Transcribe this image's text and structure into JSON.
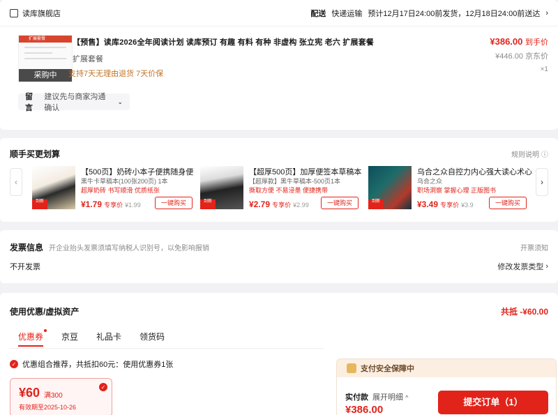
{
  "order": {
    "shop_name": "读库旗舰店",
    "ship_prefix": "配送",
    "ship_method": "快递运输",
    "ship_eta": "预计12月17日24:00前发货，12月18日24:00前送达",
    "product": {
      "thumb_header": "扩展套餐",
      "thumb_tag": "采购中",
      "title": "【预售】读库2026全年阅读计划 读库预订 有趣 有料 有种 非虚构 张立宪 老六 扩展套餐",
      "spec": "扩展套餐",
      "service": "支持7天无理由退货  7天价保",
      "price": "¥386.00",
      "price_tag": "到手价",
      "original_price": "¥446.00",
      "original_tag": "京东价",
      "qty": "×1"
    },
    "memo_label": "留言",
    "memo_value": "建议先与商家沟通确认"
  },
  "recommend": {
    "title": "顺手买更划算",
    "rule_link": "规则说明",
    "items": [
      {
        "name": "【500页】奶砖小本子便携随身便",
        "sub": "黑牛卡草稿本(100张200页)  1本",
        "tags": "超厚奶砖 书写顺滑 优质纸张",
        "price": "¥1.79",
        "price_tag": "专享价",
        "orig": "¥1.99",
        "buy": "一键购买",
        "badge": "到新"
      },
      {
        "name": "【超厚500页】加厚便签本草稿本",
        "sub": "【超厚款】黑牛草稿本-500页1本",
        "tags": "撕取方便 不易浸墨 便捷携带",
        "price": "¥2.79",
        "price_tag": "专享价",
        "orig": "¥2.99",
        "buy": "一键购买",
        "badge": "到新"
      },
      {
        "name": "乌合之众自控力内心强大读心术心",
        "sub": "乌合之众",
        "tags": "职场洞察 掌握心理 正版图书",
        "price": "¥3.49",
        "price_tag": "专享价",
        "orig": "¥3.9",
        "buy": "一键购买",
        "badge": "到新"
      }
    ]
  },
  "invoice": {
    "title": "发票信息",
    "hint": "开企业抬头发票须填写纳税人识别号，以免影响报销",
    "notice_link": "开票须知",
    "value": "不开发票",
    "modify_link": "修改发票类型"
  },
  "promo": {
    "title": "使用优惠/虚拟资产",
    "total_discount": "共抵 -¥60.00",
    "tabs": [
      "优惠券",
      "京豆",
      "礼品卡",
      "领货码"
    ],
    "recommend_text": "优惠组合推荐，共抵扣60元：使用优惠券1张",
    "coupon": {
      "amount": "¥60",
      "condition": "满300",
      "expiry": "有效期至2025-10-26"
    }
  },
  "pay": {
    "safety_title": "支付安全保障中",
    "label": "实付款",
    "expand": "展开明细",
    "amount": "¥386.00",
    "submit": "提交订单（1）"
  }
}
